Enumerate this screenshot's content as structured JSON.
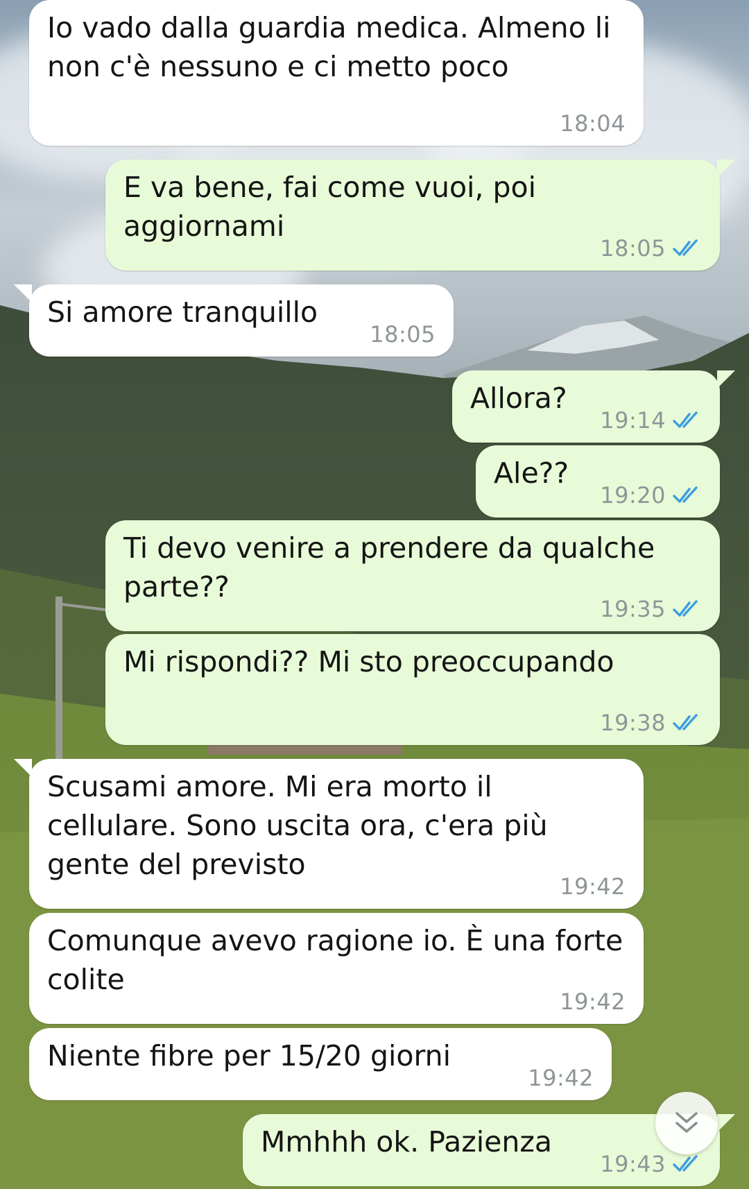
{
  "colors": {
    "incoming_bubble": "#ffffff",
    "outgoing_bubble": "#e8fbd8",
    "timestamp": "#8e9597",
    "read_ticks": "#3f9ee0"
  },
  "messages": [
    {
      "direction": "in",
      "text": "Io vado dalla guardia medica. Almeno li non c'è nessuno e ci metto poco",
      "time": "18:04",
      "read": false
    },
    {
      "direction": "out",
      "text": "E va bene, fai come vuoi, poi aggiornami",
      "time": "18:05",
      "read": true
    },
    {
      "direction": "in",
      "text": "Si amore tranquillo",
      "time": "18:05",
      "read": false
    },
    {
      "direction": "out",
      "text": "Allora?",
      "time": "19:14",
      "read": true
    },
    {
      "direction": "out",
      "text": "Ale??",
      "time": "19:20",
      "read": true
    },
    {
      "direction": "out",
      "text": "Ti devo venire a prendere da qualche parte??",
      "time": "19:35",
      "read": true
    },
    {
      "direction": "out",
      "text": "Mi rispondi?? Mi sto preoccupando",
      "time": "19:38",
      "read": true
    },
    {
      "direction": "in",
      "text": "Scusami amore. Mi era morto il cellulare. Sono uscita ora, c'era più gente del previsto",
      "time": "19:42",
      "read": false
    },
    {
      "direction": "in",
      "text": "Comunque avevo ragione io. È una forte colite",
      "time": "19:42",
      "read": false
    },
    {
      "direction": "in",
      "text": "Niente fibre per 15/20 giorni",
      "time": "19:42",
      "read": false
    },
    {
      "direction": "out",
      "text": "Mmhhh ok. Pazienza",
      "time": "19:43",
      "read": true
    }
  ],
  "scroll_button": {
    "icon": "double-chevron-down-icon"
  }
}
